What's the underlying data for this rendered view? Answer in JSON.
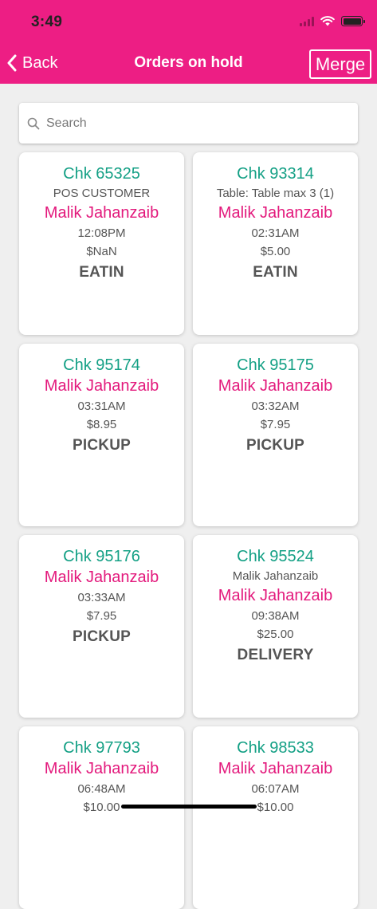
{
  "status_bar": {
    "time": "3:49"
  },
  "nav": {
    "back_label": "Back",
    "title": "Orders on hold",
    "merge_label": "Merge"
  },
  "search": {
    "placeholder": "Search"
  },
  "orders": [
    {
      "chk": "Chk 65325",
      "sub": "POS CUSTOMER",
      "name": "Malik Jahanzaib",
      "time": "12:08PM",
      "amount": "$NaN",
      "type": "EATIN"
    },
    {
      "chk": "Chk 93314",
      "sub": "Table: Table max 3 (1)",
      "name": "Malik Jahanzaib",
      "time": "02:31AM",
      "amount": "$5.00",
      "type": "EATIN"
    },
    {
      "chk": "Chk 95174",
      "sub": "",
      "name": "Malik Jahanzaib",
      "time": "03:31AM",
      "amount": "$8.95",
      "type": "PICKUP"
    },
    {
      "chk": "Chk 95175",
      "sub": "",
      "name": "Malik Jahanzaib",
      "time": "03:32AM",
      "amount": "$7.95",
      "type": "PICKUP"
    },
    {
      "chk": "Chk 95176",
      "sub": "",
      "name": "Malik Jahanzaib",
      "time": "03:33AM",
      "amount": "$7.95",
      "type": "PICKUP"
    },
    {
      "chk": "Chk 95524",
      "sub": "Malik Jahanzaib",
      "name": "Malik Jahanzaib",
      "time": "09:38AM",
      "amount": "$25.00",
      "type": "DELIVERY"
    },
    {
      "chk": "Chk 97793",
      "sub": "",
      "name": "Malik Jahanzaib",
      "time": "06:48AM",
      "amount": "$10.00",
      "type": ""
    },
    {
      "chk": "Chk 98533",
      "sub": "",
      "name": "Malik Jahanzaib",
      "time": "06:07AM",
      "amount": "$10.00",
      "type": ""
    }
  ],
  "colors": {
    "header": "#ed1e84",
    "check_number": "#14a085",
    "customer_name": "#e3197c",
    "background": "#efefef"
  },
  "icons": {
    "back": "chevron-left-icon",
    "search": "magnifier-icon",
    "wifi": "wifi-icon",
    "battery": "battery-icon",
    "signal": "signal-icon"
  }
}
